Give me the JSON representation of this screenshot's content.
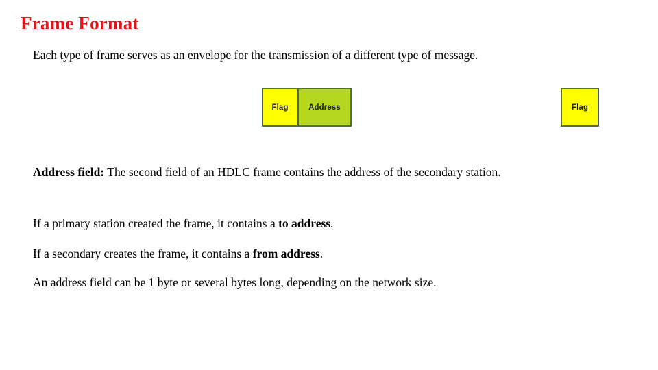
{
  "slide": {
    "title": "Frame Format",
    "title_color": "#e8121a",
    "background_color": "#ffffff"
  },
  "paragraphs": {
    "intro": {
      "text": "Each type of frame serves as an envelope for the transmission of a different type of message."
    },
    "address_field": {
      "lead": "Address field:",
      "rest": " The second field of an HDLC frame contains the address of the secondary station."
    },
    "primary": {
      "before": "If a primary station created the frame, it contains a ",
      "emphasis": "to address",
      "after": "."
    },
    "secondary": {
      "before": "If a secondary creates the frame, it contains a ",
      "emphasis": "from address",
      "after": "."
    },
    "length": {
      "text": "An address field can be 1 byte or several bytes long, depending on the network size."
    }
  },
  "frame_diagram": {
    "cells": [
      {
        "label": "Flag",
        "fill": "#ffff00",
        "border": "#54685a"
      },
      {
        "label": "Address",
        "fill": "#b5d81e",
        "border": "#54685a"
      },
      {
        "label": "Flag",
        "fill": "#ffff00",
        "border": "#54685a"
      }
    ]
  }
}
